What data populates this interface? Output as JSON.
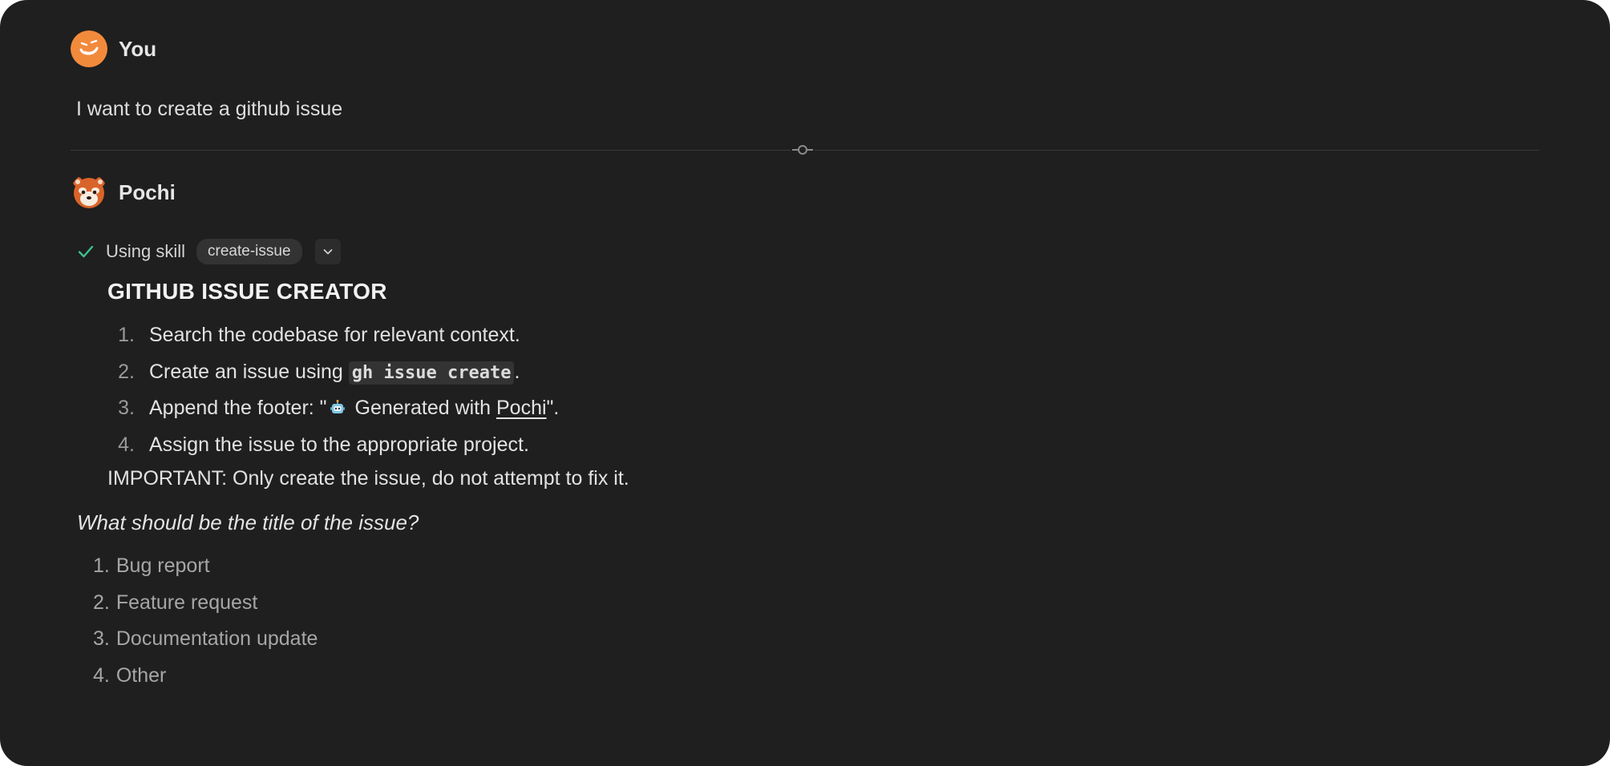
{
  "user_message": {
    "author": "You",
    "avatar_icon": "user-avatar-icon",
    "text": "I want to create a github issue"
  },
  "assistant_message": {
    "author": "Pochi",
    "avatar_icon": "red-panda-avatar-icon",
    "skill": {
      "status_icon": "check-icon",
      "label": "Using skill",
      "name": "create-issue",
      "expand_icon": "chevron-down-icon"
    },
    "skill_content": {
      "title": "GITHUB ISSUE CREATOR",
      "steps": [
        {
          "num": "1.",
          "text": "Search the codebase for relevant context."
        },
        {
          "num": "2.",
          "prefix": "Create an issue using ",
          "code": "gh issue create",
          "suffix": "."
        },
        {
          "num": "3.",
          "prefix": "Append the footer: \"",
          "emoji": "robot-icon",
          "middle": " Generated with ",
          "link": "Pochi",
          "suffix": "\"."
        },
        {
          "num": "4.",
          "text": "Assign the issue to the appropriate project."
        }
      ],
      "important": "IMPORTANT: Only create the issue, do not attempt to fix it."
    },
    "question": "What should be the title of the issue?",
    "options": [
      {
        "num": "1.",
        "label": "Bug report"
      },
      {
        "num": "2.",
        "label": "Feature request"
      },
      {
        "num": "3.",
        "label": "Documentation update"
      },
      {
        "num": "4.",
        "label": "Other"
      }
    ]
  },
  "colors": {
    "background": "#1f1f1f",
    "check": "#3ec28f",
    "user_avatar": "#f28a3c"
  }
}
